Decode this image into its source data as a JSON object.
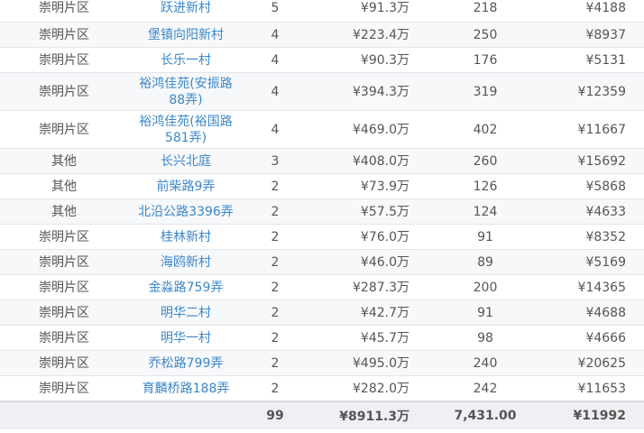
{
  "table": {
    "rows": [
      {
        "area": "崇明片区",
        "name": "跃进新村",
        "count": "5",
        "price": "¥91.3万",
        "size": "218",
        "unit": "¥4188"
      },
      {
        "area": "崇明片区",
        "name": "堡镇向阳新村",
        "count": "4",
        "price": "¥223.4万",
        "size": "250",
        "unit": "¥8937"
      },
      {
        "area": "崇明片区",
        "name": "长乐一村",
        "count": "4",
        "price": "¥90.3万",
        "size": "176",
        "unit": "¥5131"
      },
      {
        "area": "崇明片区",
        "name": "裕鸿佳苑(安振路88弄)",
        "count": "4",
        "price": "¥394.3万",
        "size": "319",
        "unit": "¥12359"
      },
      {
        "area": "崇明片区",
        "name": "裕鸿佳苑(裕国路581弄)",
        "count": "4",
        "price": "¥469.0万",
        "size": "402",
        "unit": "¥11667"
      },
      {
        "area": "其他",
        "name": "长兴北庭",
        "count": "3",
        "price": "¥408.0万",
        "size": "260",
        "unit": "¥15692"
      },
      {
        "area": "其他",
        "name": "前柴路9弄",
        "count": "2",
        "price": "¥73.9万",
        "size": "126",
        "unit": "¥5868"
      },
      {
        "area": "其他",
        "name": "北沿公路3396弄",
        "count": "2",
        "price": "¥57.5万",
        "size": "124",
        "unit": "¥4633"
      },
      {
        "area": "崇明片区",
        "name": "桂林新村",
        "count": "2",
        "price": "¥76.0万",
        "size": "91",
        "unit": "¥8352"
      },
      {
        "area": "崇明片区",
        "name": "海鸥新村",
        "count": "2",
        "price": "¥46.0万",
        "size": "89",
        "unit": "¥5169"
      },
      {
        "area": "崇明片区",
        "name": "金淼路759弄",
        "count": "2",
        "price": "¥287.3万",
        "size": "200",
        "unit": "¥14365"
      },
      {
        "area": "崇明片区",
        "name": "明华二村",
        "count": "2",
        "price": "¥42.7万",
        "size": "91",
        "unit": "¥4688"
      },
      {
        "area": "崇明片区",
        "name": "明华一村",
        "count": "2",
        "price": "¥45.7万",
        "size": "98",
        "unit": "¥4666"
      },
      {
        "area": "崇明片区",
        "name": "乔松路799弄",
        "count": "2",
        "price": "¥495.0万",
        "size": "240",
        "unit": "¥20625"
      },
      {
        "area": "崇明片区",
        "name": "育麟桥路188弄",
        "count": "2",
        "price": "¥282.0万",
        "size": "242",
        "unit": "¥11653"
      }
    ],
    "totals": {
      "area": "",
      "name": "",
      "count": "99",
      "price": "¥8911.3万",
      "size": "7,431.00",
      "unit": "¥11992"
    }
  },
  "colors": {
    "link": "#3b87c8",
    "text": "#555555",
    "stripe": "#f7f8fa",
    "footer": "#eef0f3"
  }
}
